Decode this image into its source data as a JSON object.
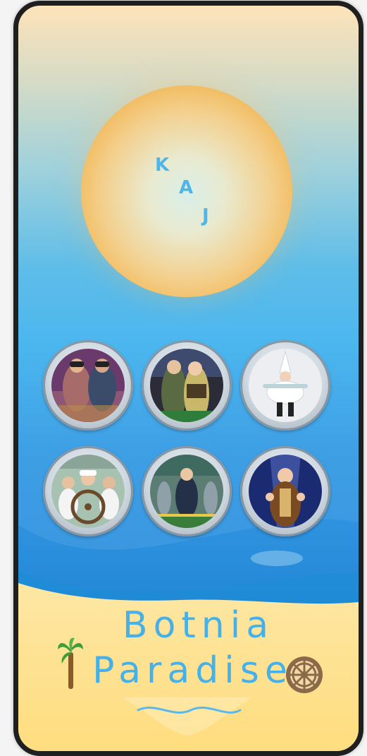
{
  "sun": {
    "letters": [
      "K",
      "A",
      "J"
    ]
  },
  "gallery": {
    "photos": [
      {
        "name": "photo-binoculars-duo"
      },
      {
        "name": "photo-soldiers-jungle"
      },
      {
        "name": "photo-cloud-costume"
      },
      {
        "name": "photo-sailors-wheel"
      },
      {
        "name": "photo-uniform-dance"
      },
      {
        "name": "photo-spotlight-singer"
      }
    ]
  },
  "title": {
    "line1": "Botnia",
    "line2": "Paradise"
  },
  "icons": {
    "palm": "palm-tree-icon",
    "wheel": "ship-wheel-icon",
    "wave": "wave-icon"
  },
  "colors": {
    "title": "#45b1ea",
    "sand": "#ffdf88",
    "sun": "#f0a93a"
  }
}
